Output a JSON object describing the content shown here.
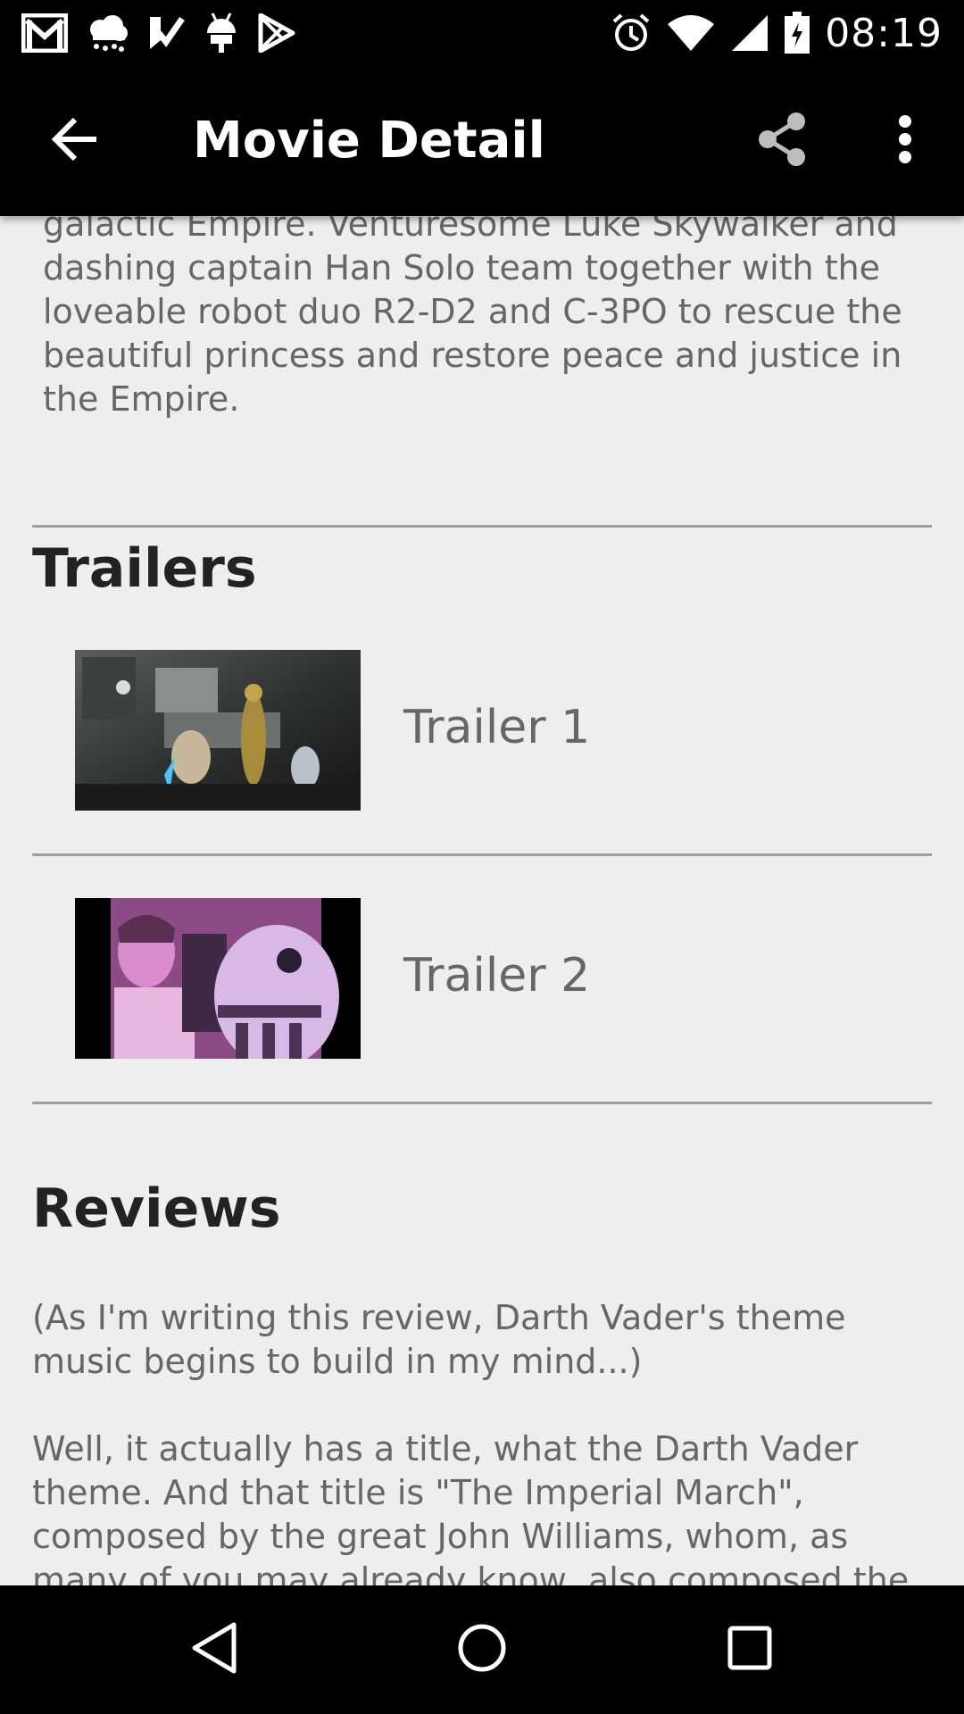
{
  "status_bar": {
    "time": "08:19",
    "left_icons": [
      "gmail-icon",
      "weather-rain-icon",
      "task-check-icon",
      "android-icon",
      "play-store-icon"
    ],
    "right_icons": [
      "alarm-icon",
      "wifi-icon",
      "signal-icon",
      "battery-icon"
    ]
  },
  "app_bar": {
    "title": "Movie Detail",
    "back_icon": "arrow-back-icon",
    "share_icon": "share-icon",
    "overflow_icon": "more-vert-icon"
  },
  "overview": {
    "text": "evil Imperial forces in their effort to take over the galactic Empire. Venturesome Luke Skywalker and dashing captain Han Solo team together with the loveable robot duo R2-D2 and C-3PO to rescue the beautiful princess and restore peace and justice in the Empire."
  },
  "trailers": {
    "heading": "Trailers",
    "items": [
      {
        "label": "Trailer 1"
      },
      {
        "label": "Trailer 2"
      }
    ]
  },
  "reviews": {
    "heading": "Reviews",
    "paragraphs": [
      "(As I'm writing this review, Darth Vader's theme music begins to build in my mind...)",
      "Well, it actually has a title, what the Darth Vader theme. And that title is \"The Imperial March\", composed by the great John Williams, whom, as many of you may already know, also composed the"
    ]
  },
  "nav_bar": {
    "back_icon": "nav-back-icon",
    "home_icon": "nav-home-icon",
    "recents_icon": "nav-recents-icon"
  },
  "colors": {
    "bar_background": "#000000",
    "content_background": "#eeeeee",
    "body_text": "#666666",
    "heading_text": "#222222",
    "divider": "#9e9e9e"
  }
}
